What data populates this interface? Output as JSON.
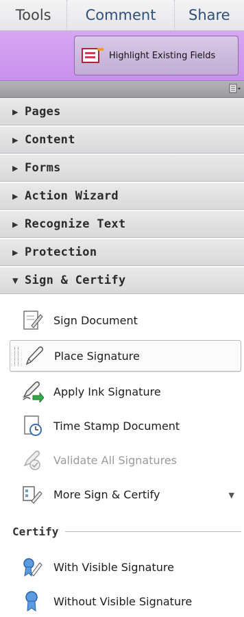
{
  "tabs": {
    "tools": "Tools",
    "comment": "Comment",
    "share": "Share"
  },
  "toolbar": {
    "highlight_label": "Highlight Existing Fields"
  },
  "panels": [
    {
      "title": "Pages",
      "expanded": false
    },
    {
      "title": "Content",
      "expanded": false
    },
    {
      "title": "Forms",
      "expanded": false
    },
    {
      "title": "Action Wizard",
      "expanded": false
    },
    {
      "title": "Recognize Text",
      "expanded": false
    },
    {
      "title": "Protection",
      "expanded": false
    },
    {
      "title": "Sign & Certify",
      "expanded": true
    }
  ],
  "sign_items": [
    {
      "label": "Sign Document",
      "icon": "sign-document-icon"
    },
    {
      "label": "Place Signature",
      "icon": "pen-icon",
      "selected": true
    },
    {
      "label": "Apply Ink Signature",
      "icon": "ink-signature-icon"
    },
    {
      "label": "Time Stamp Document",
      "icon": "timestamp-icon"
    },
    {
      "label": "Validate All Signatures",
      "icon": "validate-icon",
      "disabled": true
    },
    {
      "label": "More Sign & Certify",
      "icon": "more-icon",
      "dropdown": true
    }
  ],
  "certify": {
    "heading": "Certify",
    "items": [
      {
        "label": "With Visible Signature",
        "icon": "ribbon-pen-icon"
      },
      {
        "label": "Without Visible Signature",
        "icon": "ribbon-icon"
      }
    ]
  },
  "colors": {
    "purple_bar": "#c98fec",
    "tab_blue": "#2f4f78"
  }
}
